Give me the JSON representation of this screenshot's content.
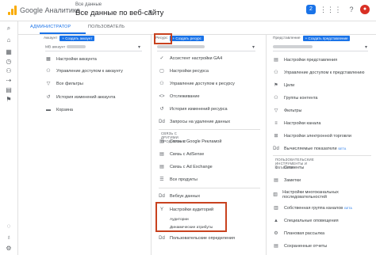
{
  "header": {
    "brand": "Google Аналитика",
    "selector_sub": "Все данные",
    "selector_main": "Все данные по веб-сайту",
    "badge": "2"
  },
  "tabs": [
    "АДМИНИСТРАТОР",
    "ПОЛЬЗОВАТЕЛЬ"
  ],
  "columns": {
    "account": {
      "label": "Аккаунт",
      "button": "+ Создать аккаунт",
      "selector": "МВ аккаунт",
      "items": [
        {
          "icon": "building-icon",
          "glyph": "▦",
          "label": "Настройки аккаунта"
        },
        {
          "icon": "people-icon",
          "glyph": "⚇",
          "label": "Управление доступом к аккаунту"
        },
        {
          "icon": "filter-icon",
          "glyph": "▽",
          "label": "Все фильтры"
        },
        {
          "icon": "history-icon",
          "glyph": "↺",
          "label": "История изменений аккаунта"
        },
        {
          "icon": "trash-icon",
          "glyph": "▬",
          "label": "Корзина"
        }
      ]
    },
    "property": {
      "label": "Ресурс",
      "button": "+ Создать ресурс",
      "items": [
        {
          "icon": "check-icon",
          "glyph": "✓",
          "label": "Ассистент настройки GA4"
        },
        {
          "icon": "square-icon",
          "glyph": "▢",
          "label": "Настройки ресурса"
        },
        {
          "icon": "people-icon",
          "glyph": "⚇",
          "label": "Управление доступом к ресурсу"
        },
        {
          "icon": "code-icon",
          "glyph": "<>",
          "label": "Отслеживание"
        },
        {
          "icon": "history-icon",
          "glyph": "↺",
          "label": "История изменений ресурса"
        },
        {
          "icon": "dd-icon",
          "glyph": "Dd",
          "label": "Запросы на удаление данных"
        }
      ],
      "section1": "СВЯЗЬ С ДРУГИМИ ПРОДУКТАМИ",
      "links": [
        {
          "icon": "ads-icon",
          "glyph": "▤",
          "label": "Связь с Google Рекламой"
        },
        {
          "icon": "adsense-icon",
          "glyph": "▤",
          "label": "Связь с AdSense"
        },
        {
          "icon": "adexchange-icon",
          "glyph": "▤",
          "label": "Связь с Ad Exchange"
        },
        {
          "icon": "products-icon",
          "glyph": "☰",
          "label": "Все продукты"
        }
      ],
      "more": [
        {
          "icon": "dd-icon",
          "glyph": "Dd",
          "label": "Вебхук данных"
        },
        {
          "icon": "audience-icon",
          "glyph": "Y",
          "label": "Настройки аудиторий"
        }
      ],
      "sub": [
        "Аудитории",
        "Динамические атрибуты"
      ],
      "last": {
        "icon": "code-icon",
        "glyph": "Dd",
        "label": "Пользовательские определения"
      }
    },
    "view": {
      "label": "Представление",
      "button": "+ Создать представление",
      "items": [
        {
          "icon": "doc-icon",
          "glyph": "▤",
          "label": "Настройки представления"
        },
        {
          "icon": "people-icon",
          "glyph": "⚇",
          "label": "Управление доступом к представлению"
        },
        {
          "icon": "flag-icon",
          "glyph": "⚑",
          "label": "Цели"
        },
        {
          "icon": "group-icon",
          "glyph": "⚇",
          "label": "Группы контента"
        },
        {
          "icon": "filter-icon",
          "glyph": "▽",
          "label": "Фильтры"
        },
        {
          "icon": "channel-icon",
          "glyph": "≡",
          "label": "Настройки канала"
        },
        {
          "icon": "cart-icon",
          "glyph": "⊞",
          "label": "Настройки электронной торговли"
        },
        {
          "icon": "calc-icon",
          "glyph": "Dd",
          "label": "Вычисляемые показатели",
          "tag": "БЕТА"
        }
      ],
      "section": "ПОЛЬЗОВАТЕЛЬСКИЕ ИНСТРУМЕНТЫ И ОБЪЕКТЫ",
      "tools": [
        {
          "icon": "segment-icon",
          "glyph": "≡",
          "label": "Сегменты"
        },
        {
          "icon": "note-icon",
          "glyph": "▤",
          "label": "Заметки"
        },
        {
          "icon": "mcf-icon",
          "glyph": "▥",
          "label": "Настройки многоканальных последовательностей"
        },
        {
          "icon": "channel-group-icon",
          "glyph": "▥",
          "label": "Собственная группа каналов",
          "tag": "БЕТА"
        },
        {
          "icon": "alert-icon",
          "glyph": "▲",
          "label": "Специальные оповещения"
        },
        {
          "icon": "email-icon",
          "glyph": "⚙",
          "label": "Плановая рассылка"
        },
        {
          "icon": "report-icon",
          "glyph": "▤",
          "label": "Сохраненные отчеты"
        }
      ]
    }
  }
}
